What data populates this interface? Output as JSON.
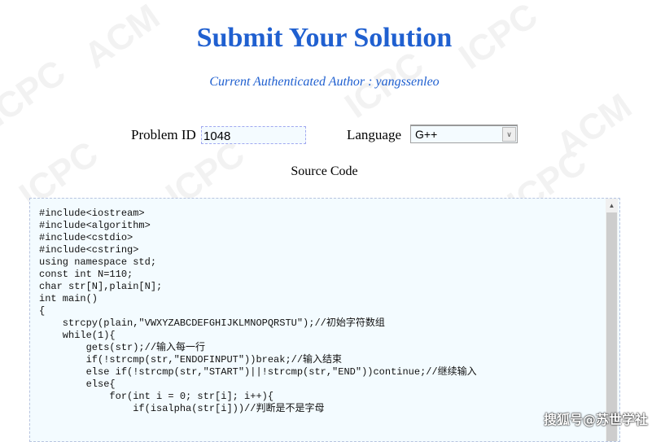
{
  "header": {
    "title": "Submit Your Solution",
    "author_line": "Current Authenticated Author : yangssenleo"
  },
  "form": {
    "problem_id_label": "Problem ID",
    "problem_id_value": "1048",
    "language_label": "Language",
    "language_value": "G++",
    "source_label": "Source Code"
  },
  "code_lines": [
    "#include<iostream>",
    "#include<algorithm>",
    "#include<cstdio>",
    "#include<cstring>",
    "using namespace std;",
    "const int N=110;",
    "char str[N],plain[N];",
    "int main()",
    "{",
    "    strcpy(plain,\"VWXYZABCDEFGHIJKLMNOPQRSTU\");//初始字符数组",
    "    while(1){",
    "        gets(str);//输入每一行",
    "        if(!strcmp(str,\"ENDOFINPUT\"))break;//输入结束",
    "        else if(!strcmp(str,\"START\")||!strcmp(str,\"END\"))continue;//继续输入",
    "        else{",
    "            for(int i = 0; str[i]; i++){",
    "                if(isalpha(str[i]))//判断是不是字母"
  ],
  "watermarks": [
    "ACM",
    "ICPC"
  ],
  "credit": "搜狐号@苏世学社",
  "colors": {
    "title": "#2060d0",
    "code_bg": "#f3fbff"
  }
}
